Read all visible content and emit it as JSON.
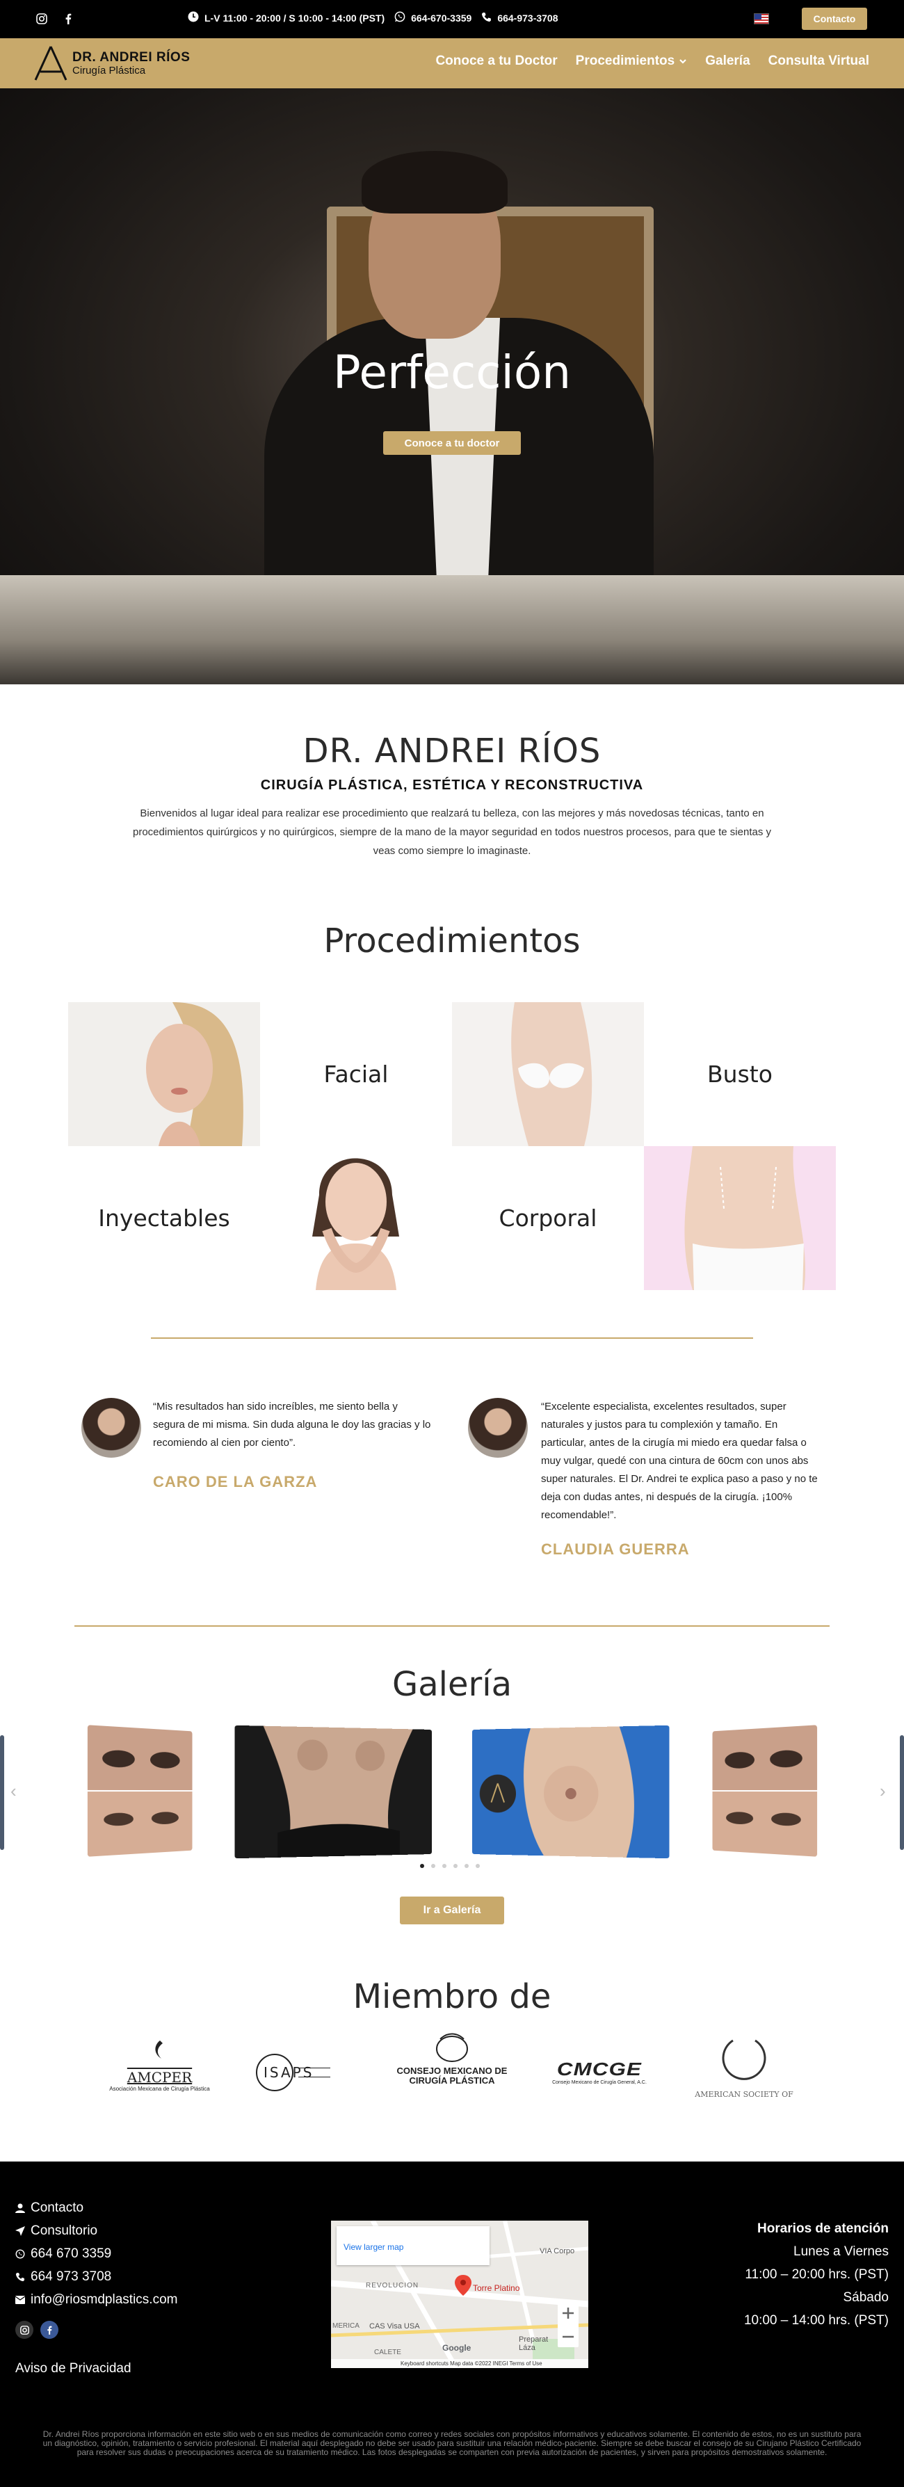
{
  "topbar": {
    "hours": "L-V 11:00 - 20:00 / S 10:00 - 14:00 (PST)",
    "whatsapp": "664-670-3359",
    "phone": "664-973-3708",
    "contact_label": "Contacto"
  },
  "nav": {
    "logo_name": "DR. ANDREI RÍOS",
    "logo_sub": "Cirugía Plástica",
    "items": [
      "Conoce a tu Doctor",
      "Procedimientos",
      "Galería",
      "Consulta Virtual"
    ]
  },
  "hero": {
    "title": "Perfección",
    "button": "Conoce a tu doctor"
  },
  "intro": {
    "title": "DR. ANDREI RÍOS",
    "subtitle": "CIRUGÍA PLÁSTICA, ESTÉTICA Y RECONSTRUCTIVA",
    "text": "Bienvenidos al lugar ideal para realizar ese procedimiento que realzará tu belleza, con las mejores y más novedosas técnicas, tanto en procedimientos quirúrgicos y  no quirúrgicos, siempre de la mano de la mayor seguridad en todos nuestros procesos, para que te sientas y veas como siempre lo imaginaste."
  },
  "procedures": {
    "title": "Procedimientos",
    "items": [
      "Facial",
      "Busto",
      "Inyectables",
      "Corporal"
    ]
  },
  "testimonials": [
    {
      "quote": "“Mis resultados han sido increíbles, me siento bella y segura de mi misma. Sin duda alguna le doy las gracias y lo recomiendo al cien por ciento”.",
      "author": "CARO DE LA GARZA"
    },
    {
      "quote": "“Excelente especialista, excelentes resultados, super naturales y justos para tu complexión y tamaño. En particular, antes de la cirugía mi miedo era quedar falsa o muy vulgar, quedé con una cintura de 60cm con unos abs super naturales. El Dr. Andrei te explica paso a paso y no te deja con dudas antes, ni después de la cirugía. ¡100% recomendable!”.",
      "author": "CLAUDIA GUERRA"
    }
  ],
  "gallery": {
    "title": "Galería",
    "button": "Ir a Galería",
    "dots": 6,
    "active_dot": 0
  },
  "members": {
    "title": "Miembro de",
    "logos": [
      {
        "name": "AMCPER",
        "sub": "Asociación Mexicana de Cirugía Plástica"
      },
      {
        "name": "ISAPS",
        "sub": ""
      },
      {
        "name": "CONSEJO MEXICANO DE CIRUGÍA PLÁSTICA",
        "sub": ""
      },
      {
        "name": "CMCGE",
        "sub": "Consejo Mexicano de Cirugía General, A.C."
      },
      {
        "name": "AMERICAN SOCIETY OF",
        "sub": ""
      }
    ]
  },
  "footer": {
    "links": [
      "Contacto",
      "Consultorio",
      "664 670 3359",
      "664 973 3708",
      "info@riosmdplastics.com"
    ],
    "privacy": "Aviso de Privacidad",
    "map": {
      "place": "Torre Platino",
      "link": "View larger map",
      "pin_label": "Torre Platino",
      "labels": [
        "VIA Corpo",
        "REVOLUCION",
        "CAS Visa USA",
        "Preparat Láza",
        "MERICA",
        "CALETE"
      ],
      "attribution": "Keyboard shortcuts   Map data ©2022 INEGI   Terms of Use"
    },
    "hours": [
      "Horarios de atención",
      "Lunes a Viernes",
      "11:00 – 20:00 hrs. (PST)",
      "Sábado",
      "10:00 – 14:00 hrs. (PST)"
    ],
    "disclaimer": "Dr. Andrei Ríos proporciona información en este sitio web o en sus medios de comunicación como correo y redes sociales con propósitos informativos y educativos solamente. El contenido de estos, no es un sustituto para un diagnóstico, opinión, tratamiento o servicio profesional. El material aquí desplegado no debe ser usado para sustituir una relación médico-paciente. Siempre se debe buscar el consejo de su Cirujano Plástico Certificado para resolver sus dudas o preocupaciones acerca de su tratamiento médico. Las fotos desplegadas se comparten con previa autorización de pacientes, y sirven para propósitos demostrativos solamente."
  },
  "colors": {
    "gold": "#c8a96b",
    "black": "#000000"
  }
}
